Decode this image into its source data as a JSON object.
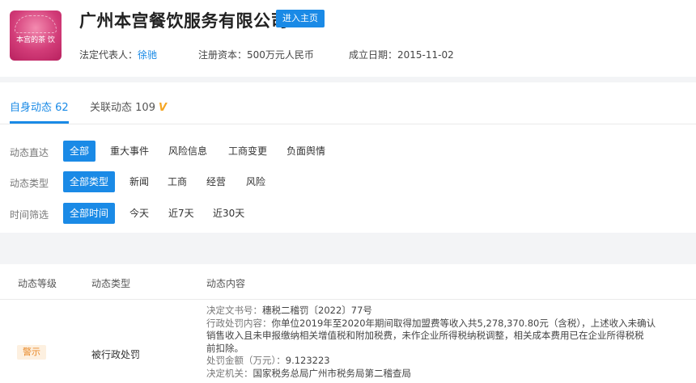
{
  "company": {
    "logo_text": "本宫的茶 饮",
    "name": "广州本宫餐饮服务有限公司",
    "home_button": "进入主页",
    "legal_rep_label": "法定代表人：",
    "legal_rep_value": "徐驰",
    "capital_label": "注册资本：",
    "capital_value": "500万元人民币",
    "date_label": "成立日期：",
    "date_value": "2015-11-02"
  },
  "tabs": {
    "self_label": "自身动态",
    "self_count": "62",
    "related_label": "关联动态",
    "related_count": "109",
    "vip_icon": "V"
  },
  "filters": {
    "direct": {
      "label": "动态直达",
      "options": [
        "全部",
        "重大事件",
        "风险信息",
        "工商变更",
        "负面舆情"
      ],
      "selected": 0
    },
    "type": {
      "label": "动态类型",
      "options": [
        "全部类型",
        "新闻",
        "工商",
        "经营",
        "风险"
      ],
      "selected": 0
    },
    "time": {
      "label": "时间筛选",
      "options": [
        "全部时间",
        "今天",
        "近7天",
        "近30天"
      ],
      "selected": 0
    }
  },
  "table": {
    "headers": [
      "动态等级",
      "动态类型",
      "动态内容"
    ],
    "rows": [
      {
        "level": "警示",
        "type": "被行政处罚",
        "doc_label": "决定文书号：",
        "doc_value": "穗税二稽罚〔2022〕77号",
        "penalty_label": "行政处罚内容：",
        "penalty_line1": "你单位2019年至2020年期间取得加盟费等收入共5,278,370.80元（含税），上述收入未确认",
        "penalty_line2": "销售收入且未申报缴纳相关增值税和附加税费，未作企业所得税纳税调整，相关成本费用已在企业所得税税",
        "penalty_line3": "前扣除。",
        "amount_label": "处罚金额（万元）：",
        "amount_value": "9.123223",
        "authority_label": "决定机关：",
        "authority_value": "国家税务总局广州市税务局第二稽查局"
      }
    ]
  },
  "colors": {
    "accent": "#1a8ae6",
    "warning": "#e98a2a",
    "warning_bg": "#fdf0e0",
    "vip": "#f5a623"
  }
}
